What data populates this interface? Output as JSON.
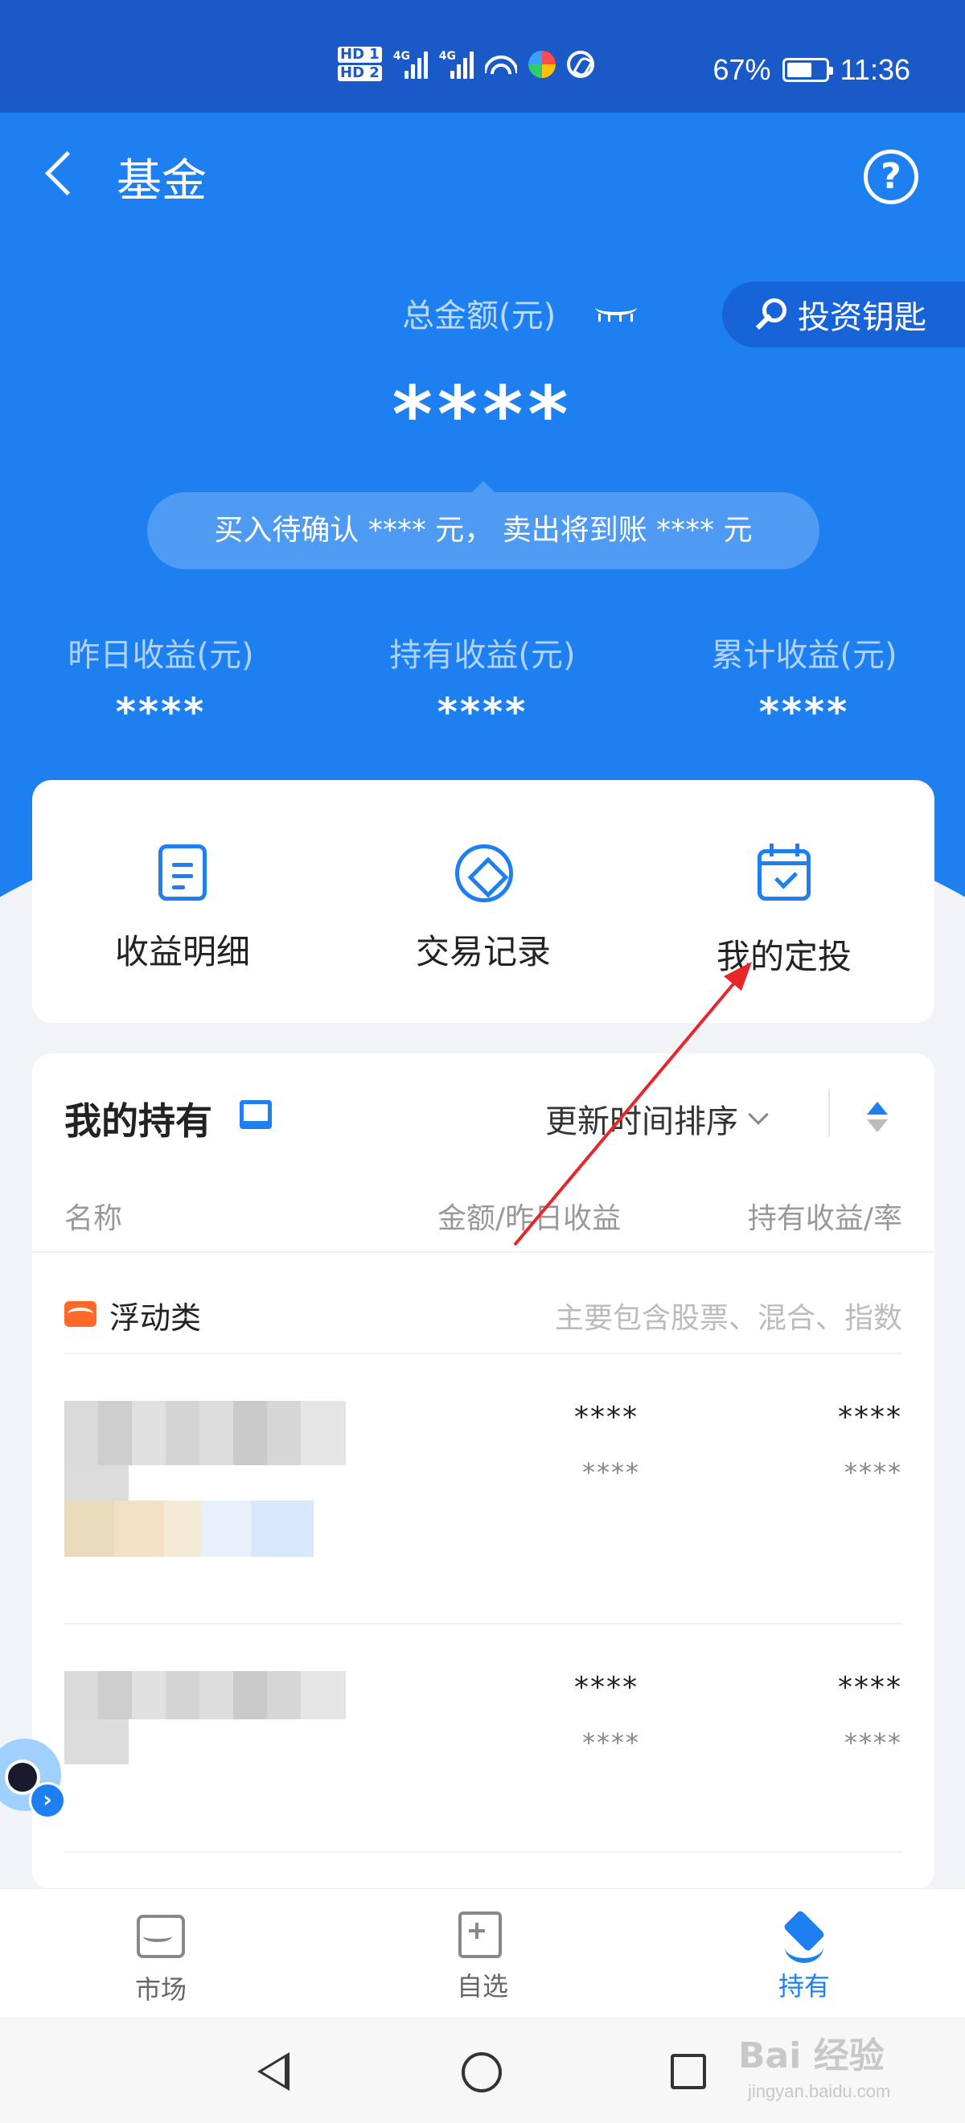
{
  "status_bar": {
    "hd1": "HD 1",
    "hd2": "HD 2",
    "net1": "4G",
    "net2": "4G",
    "battery": "67%",
    "time": "11:36"
  },
  "header": {
    "title": "基金",
    "total_label": "总金额(元)",
    "invest_key_label": "投资钥匙",
    "total_value": "****",
    "pending_text": "买入待确认 **** 元， 卖出将到账 **** 元"
  },
  "stats": [
    {
      "label": "昨日收益(元)",
      "value": "****"
    },
    {
      "label": "持有收益(元)",
      "value": "****"
    },
    {
      "label": "累计收益(元)",
      "value": "****"
    }
  ],
  "actions": [
    {
      "label": "收益明细",
      "icon": "document-icon"
    },
    {
      "label": "交易记录",
      "icon": "diamond-ring-icon"
    },
    {
      "label": "我的定投",
      "icon": "calendar-check-icon"
    }
  ],
  "holdings": {
    "title": "我的持有",
    "sort_label": "更新时间排序",
    "columns": [
      "名称",
      "金额/昨日收益",
      "持有收益/率"
    ],
    "category": {
      "name": "浮动类",
      "description": "主要包含股票、混合、指数"
    },
    "rows": [
      {
        "amount": "****",
        "yesterday": "****",
        "profit": "****",
        "rate": "****"
      },
      {
        "amount": "****",
        "yesterday": "****",
        "profit": "****",
        "rate": "****"
      }
    ]
  },
  "bottom_nav": [
    {
      "label": "市场",
      "icon": "market-icon",
      "active": false
    },
    {
      "label": "自选",
      "icon": "watchlist-icon",
      "active": false
    },
    {
      "label": "持有",
      "icon": "holdings-icon",
      "active": true
    }
  ],
  "colors": {
    "brand_blue": "#1e7ff0",
    "status_bar": "#1a59c8",
    "annotation_red": "#e8262a"
  },
  "watermark": {
    "text": "Bai 经验",
    "sub": "jingyan.baidu.com"
  }
}
